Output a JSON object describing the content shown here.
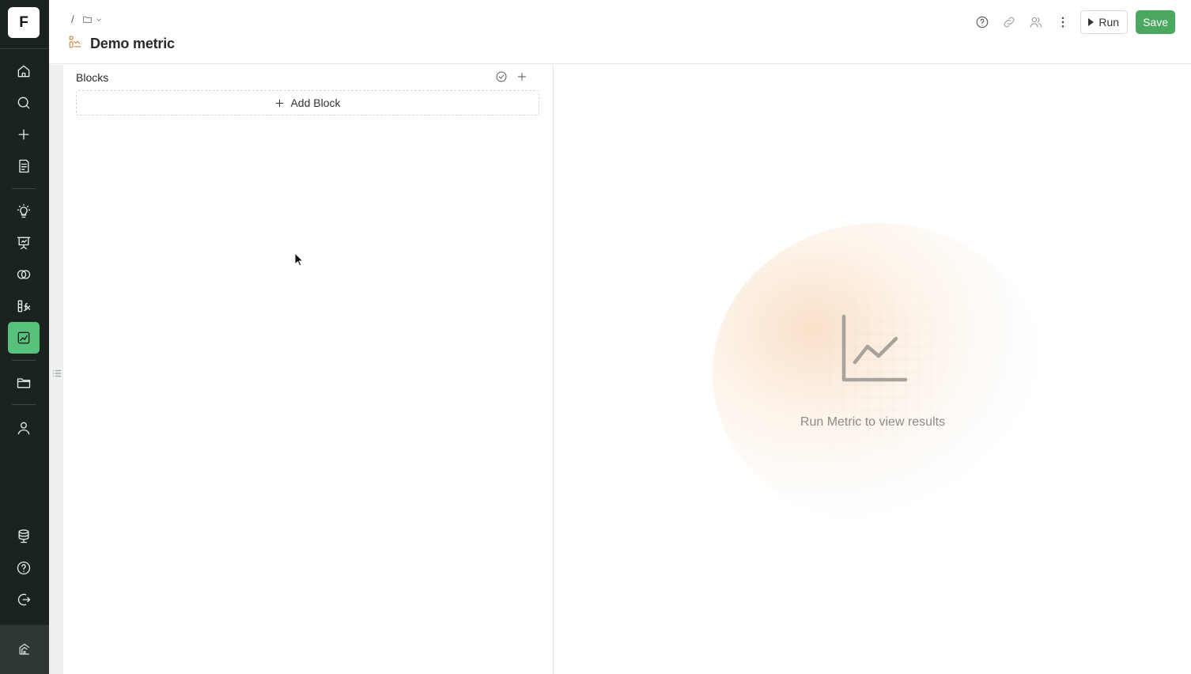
{
  "sidebar": {
    "logo_letter": "F",
    "items": [
      {
        "id": "home",
        "icon": "home-icon"
      },
      {
        "id": "search",
        "icon": "search-icon"
      },
      {
        "id": "create",
        "icon": "plus-icon"
      },
      {
        "id": "notes",
        "icon": "notebook-icon"
      },
      {
        "id": "insights",
        "icon": "lightbulb-icon"
      },
      {
        "id": "presentations",
        "icon": "presentation-icon"
      },
      {
        "id": "segments",
        "icon": "overlap-circles-icon"
      },
      {
        "id": "formulas",
        "icon": "formula-icon"
      },
      {
        "id": "metrics",
        "icon": "line-chart-icon",
        "active": true
      },
      {
        "id": "folders",
        "icon": "folder-icon"
      },
      {
        "id": "profile",
        "icon": "user-icon"
      },
      {
        "id": "data-sources",
        "icon": "database-icon"
      },
      {
        "id": "help",
        "icon": "help-icon"
      },
      {
        "id": "logout",
        "icon": "logout-icon"
      }
    ],
    "footer_icon": "brand-icon"
  },
  "header": {
    "breadcrumb_separator": "/",
    "title": "Demo metric",
    "run_label": "Run",
    "save_label": "Save"
  },
  "blocks": {
    "heading": "Blocks",
    "add_label": "Add Block"
  },
  "results": {
    "empty_message": "Run Metric to view results"
  },
  "colors": {
    "sidebar_bg": "#1b2320",
    "active_nav": "#58c27d",
    "save_button": "#4aa860",
    "metric_icon": "#d28a4d"
  }
}
